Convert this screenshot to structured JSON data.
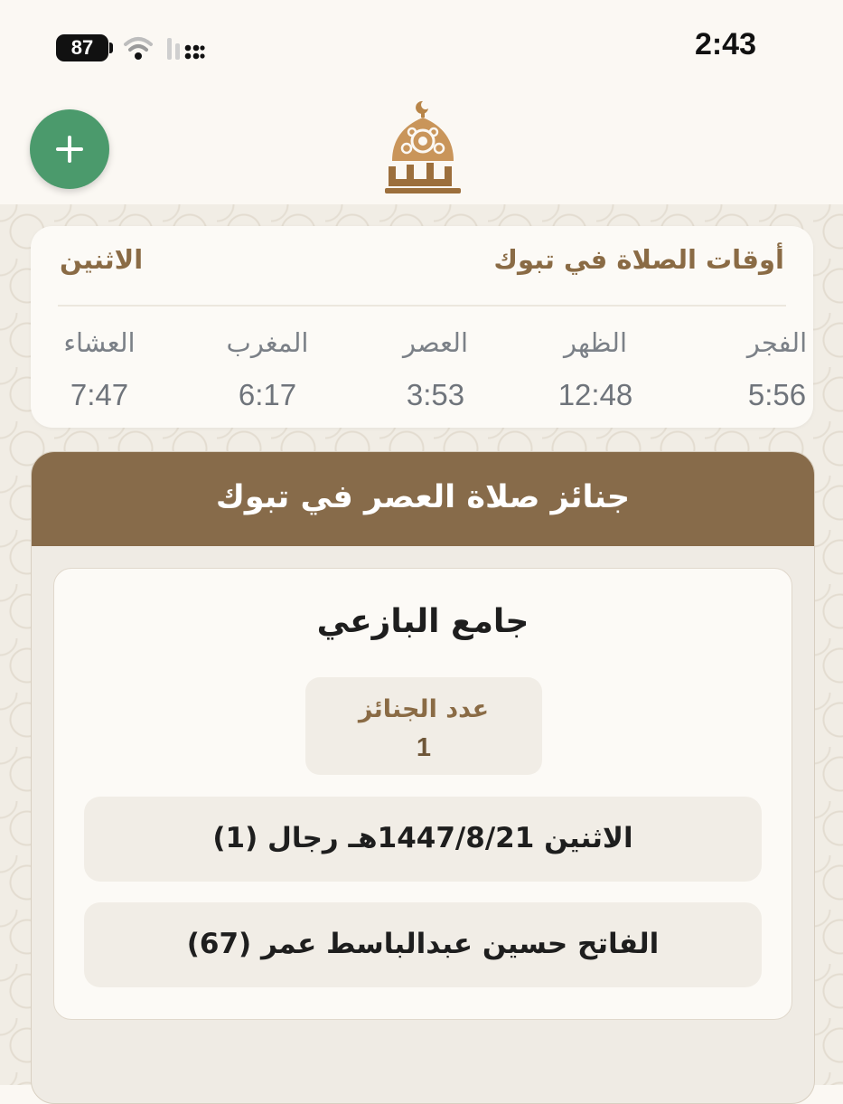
{
  "status": {
    "battery": "87",
    "time": "2:43"
  },
  "header": {
    "add_icon": "plus-icon",
    "logo_icon": "mosque-dome-logo"
  },
  "prayer_times": {
    "title": "أوقات الصلاة في تبوك",
    "day": "الاثنين",
    "prayers": [
      {
        "name": "الفجر",
        "time": "5:56"
      },
      {
        "name": "الظهر",
        "time": "12:48"
      },
      {
        "name": "العصر",
        "time": "3:53"
      },
      {
        "name": "المغرب",
        "time": "6:17"
      },
      {
        "name": "العشاء",
        "time": "7:47"
      }
    ]
  },
  "funerals": {
    "title": "جنائز صلاة العصر في تبوك",
    "mosque": {
      "name": "جامع البازعي",
      "count_label": "عدد الجنائز",
      "count_value": "1",
      "entries": [
        "الاثنين 1447/8/21هـ رجال (1)",
        "الفاتح حسين عبدالباسط عمر (67)"
      ]
    }
  },
  "colors": {
    "brand_brown": "#876b4a",
    "accent_gold": "#8a6b45",
    "add_green": "#4b9a6c"
  }
}
